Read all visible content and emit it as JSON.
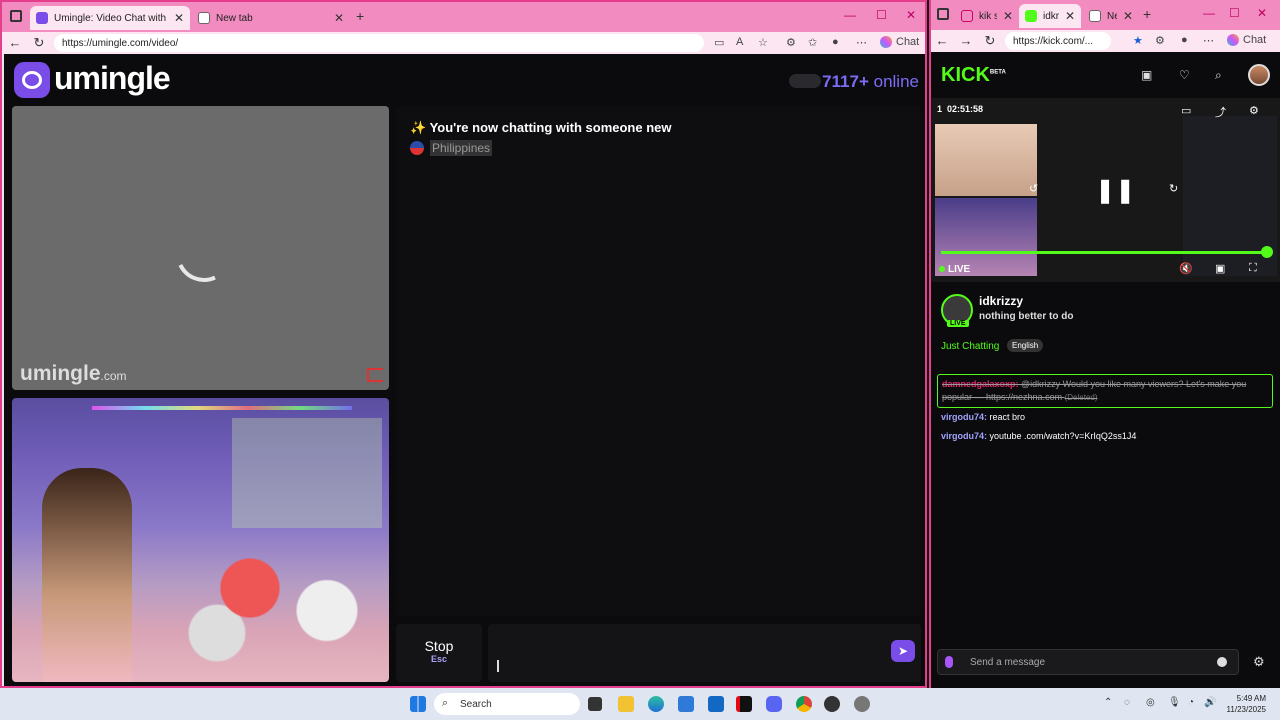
{
  "left_browser": {
    "tabs": [
      {
        "label": "Umingle: Video Chat with St",
        "active": true
      },
      {
        "label": "New tab",
        "active": false
      }
    ],
    "url": "https://umingle.com/video/",
    "chat_label": "Chat"
  },
  "umingle": {
    "logo_text": "umingle",
    "online_count": "7117+",
    "online_label": "online",
    "watermark": "umingle",
    "watermark_suffix": ".com",
    "system_message": "✨ You're now chatting with someone new",
    "country": "Philippines",
    "stop_label": "Stop",
    "stop_shortcut": "Esc"
  },
  "right_browser": {
    "tabs": [
      {
        "label": "kik st",
        "active": false
      },
      {
        "label": "idkriz",
        "active": true
      },
      {
        "label": "New",
        "active": false
      }
    ],
    "url": "https://kick.com/...",
    "chat_label": "Chat"
  },
  "kick": {
    "logo": "KICK",
    "logo_sup": "BETA",
    "player_time": "02:51:58",
    "player_count": "1",
    "live_label": "LIVE",
    "channel_name": "idkrizzy",
    "live_badge": "LIVE",
    "stream_title": "nothing better to do",
    "category": "Just Chatting",
    "language_tag": "English",
    "messages": [
      {
        "user": "damnedgalaxoxp:",
        "text": " @idkrizzy Would you like many viewers? Let's make you popular — https://nezhna.com",
        "deleted_label": "(Deleted)"
      },
      {
        "user": "virgodu74:",
        "text": " react bro"
      },
      {
        "user": "virgodu74:",
        "text": " youtube .com/watch?v=KrIqQ2ss1J4"
      }
    ],
    "chat_placeholder": "Send a message"
  },
  "taskbar": {
    "search_label": "Search",
    "time": "5:49 AM",
    "date": "11/23/2025"
  },
  "colors": {
    "accent_pink": "#e53e8c",
    "umingle_purple": "#7a4de8",
    "kick_green": "#53fc18"
  }
}
